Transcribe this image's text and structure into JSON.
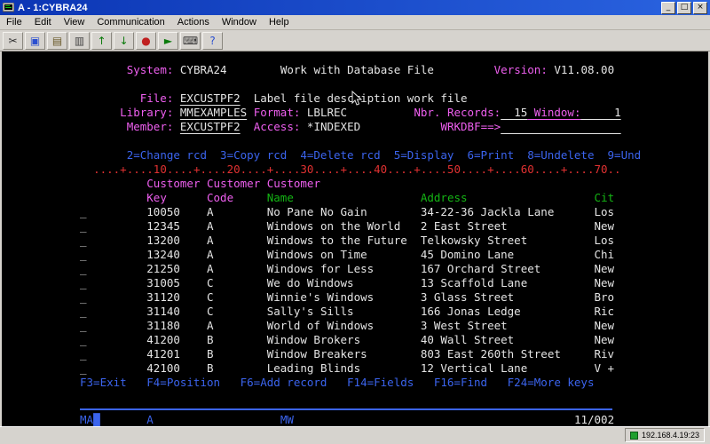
{
  "window": {
    "title": "A - 1:CYBRA24",
    "controls": {
      "minimize": "_",
      "maximize": "□",
      "close": "×"
    }
  },
  "menu": {
    "items": [
      "File",
      "Edit",
      "View",
      "Communication",
      "Actions",
      "Window",
      "Help"
    ]
  },
  "toolbar": {
    "buttons": [
      {
        "name": "cut-icon",
        "glyph": "✂",
        "color": "#333333"
      },
      {
        "name": "copy-icon",
        "glyph": "▣",
        "color": "#2a4fd0"
      },
      {
        "name": "paste-icon",
        "glyph": "▤",
        "color": "#6a5a2a"
      },
      {
        "name": "print-icon",
        "glyph": "▥",
        "color": "#444444"
      },
      {
        "name": "send-file-icon",
        "glyph": "↑",
        "color": "#0a7a0a"
      },
      {
        "name": "receive-file-icon",
        "glyph": "↓",
        "color": "#0a7a0a"
      },
      {
        "name": "record-macro-icon",
        "glyph": "●",
        "color": "#c02020"
      },
      {
        "name": "play-macro-icon",
        "glyph": "►",
        "color": "#0a7a0a"
      },
      {
        "name": "keyboard-icon",
        "glyph": "⌨",
        "color": "#333333"
      },
      {
        "name": "help-icon",
        "glyph": "?",
        "color": "#2a4fd0"
      }
    ]
  },
  "screen": {
    "top_lines": [
      [
        {
          "pad": 7
        },
        {
          "t": "System: ",
          "c": "p"
        },
        {
          "t": "CYBRA24"
        },
        {
          "pad": 8
        },
        {
          "t": "Work with Database File"
        },
        {
          "pad": 9
        },
        {
          "t": "Version: ",
          "c": "p"
        },
        {
          "t": "V11.08.00"
        }
      ],
      [],
      [
        {
          "pad": 9
        },
        {
          "t": "File: ",
          "c": "p"
        },
        {
          "t": "EXCUSTPF2",
          "u": 1,
          "n": "file-name-field",
          "i": 1
        },
        {
          "pad": 2
        },
        {
          "t": "Label file description work file"
        }
      ],
      [
        {
          "pad": 6
        },
        {
          "t": "Library: ",
          "c": "p"
        },
        {
          "t": "MMEXAMPLES",
          "u": 1,
          "n": "library-field",
          "i": 1
        },
        {
          "pad": 1
        },
        {
          "t": "Format: ",
          "c": "p"
        },
        {
          "t": "LBLREC"
        },
        {
          "pad": 10
        },
        {
          "t": "Nbr. Records:",
          "c": "p"
        },
        {
          "t": "  15",
          "u": 1,
          "n": "records-count"
        },
        {
          "t": " Window:",
          "c": "p",
          "u": 1
        },
        {
          "t": "     1",
          "u": 1,
          "n": "window-field",
          "i": 1
        }
      ],
      [
        {
          "pad": 7
        },
        {
          "t": "Member: ",
          "c": "p"
        },
        {
          "t": "EXCUSTPF2",
          "u": 1,
          "n": "member-field",
          "i": 1
        },
        {
          "pad": 2
        },
        {
          "t": "Access: ",
          "c": "p"
        },
        {
          "t": "*INDEXED"
        },
        {
          "pad": 12
        },
        {
          "t": "WRKDBF==>",
          "c": "p"
        },
        {
          "pad": 18,
          "u": 1,
          "n": "command-field",
          "i": 1
        }
      ],
      [],
      [
        {
          "pad": 7
        },
        {
          "t": "2=Change rcd  3=Copy rcd  4=Delete rcd  5=Display  6=Print  8=Undelete  9=Und",
          "c": "b"
        }
      ],
      [
        {
          "pad": 2
        },
        {
          "t": "....+....10....+....20....+....30....+....40....+....50....+....60....+....70..",
          "c": "r"
        }
      ],
      [
        {
          "pad": 10
        },
        {
          "t": "Customer",
          "c": "p"
        },
        {
          "pad": 1
        },
        {
          "t": "Customer",
          "c": "p"
        },
        {
          "pad": 1
        },
        {
          "t": "Customer",
          "c": "p"
        }
      ],
      [
        {
          "pad": 10
        },
        {
          "t": "Key",
          "c": "p"
        },
        {
          "pad": 6
        },
        {
          "t": "Code",
          "c": "p"
        },
        {
          "pad": 5
        },
        {
          "t": "Name",
          "c": "g"
        },
        {
          "pad": 19
        },
        {
          "t": "Address",
          "c": "g"
        },
        {
          "pad": 19
        },
        {
          "t": "Cit",
          "c": "g"
        }
      ]
    ],
    "records": [
      {
        "opt": "_",
        "key": "10050",
        "code": "A",
        "name": "No Pane No Gain",
        "address": "34-22-36 Jackla Lane",
        "city": "Los"
      },
      {
        "opt": "_",
        "key": "12345",
        "code": "A",
        "name": "Windows on the World",
        "address": "2 East Street",
        "city": "New"
      },
      {
        "opt": "_",
        "key": "13200",
        "code": "A",
        "name": "Windows to the Future",
        "address": "Telkowsky Street",
        "city": "Los"
      },
      {
        "opt": "_",
        "key": "13240",
        "code": "A",
        "name": "Windows on Time",
        "address": "45 Domino Lane",
        "city": "Chi"
      },
      {
        "opt": "_",
        "key": "21250",
        "code": "A",
        "name": "Windows for Less",
        "address": "167 Orchard Street",
        "city": "New"
      },
      {
        "opt": "_",
        "key": "31005",
        "code": "C",
        "name": "We do Windows",
        "address": "13 Scaffold Lane",
        "city": "New"
      },
      {
        "opt": "_",
        "key": "31120",
        "code": "C",
        "name": "Winnie's Windows",
        "address": "3 Glass Street",
        "city": "Bro"
      },
      {
        "opt": "_",
        "key": "31140",
        "code": "C",
        "name": "Sally's Sills",
        "address": "166 Jonas Ledge",
        "city": "Ric"
      },
      {
        "opt": "_",
        "key": "31180",
        "code": "A",
        "name": "World of Windows",
        "address": "3 West Street",
        "city": "New"
      },
      {
        "opt": "_",
        "key": "41200",
        "code": "B",
        "name": "Window Brokers",
        "address": "40 Wall Street",
        "city": "New"
      },
      {
        "opt": "_",
        "key": "41201",
        "code": "B",
        "name": "Window Breakers",
        "address": "803 East 260th Street",
        "city": "Riv"
      },
      {
        "opt": "_",
        "key": "42100",
        "code": "B",
        "name": "Leading Blinds",
        "address": "12 Vertical Lane",
        "city": "V +"
      }
    ],
    "fkeys": [
      {
        "t": "F3=Exit   F4=Position   F6=Add record   F14=Fields   F16=Find   F24=More keys",
        "c": "b"
      }
    ],
    "oia": [
      {
        "t": "MA",
        "c": "b"
      },
      {
        "t": "█",
        "c": "b",
        "n": "cursor-indicator"
      },
      {
        "pad": 7
      },
      {
        "t": "A",
        "c": "b"
      },
      {
        "pad": 19
      },
      {
        "t": "MW",
        "c": "b"
      },
      {
        "pad": 42
      },
      {
        "t": "11/002",
        "c": "w",
        "n": "cursor-position"
      }
    ]
  },
  "statusbar": {
    "connection": "192.168.4.19:23"
  }
}
